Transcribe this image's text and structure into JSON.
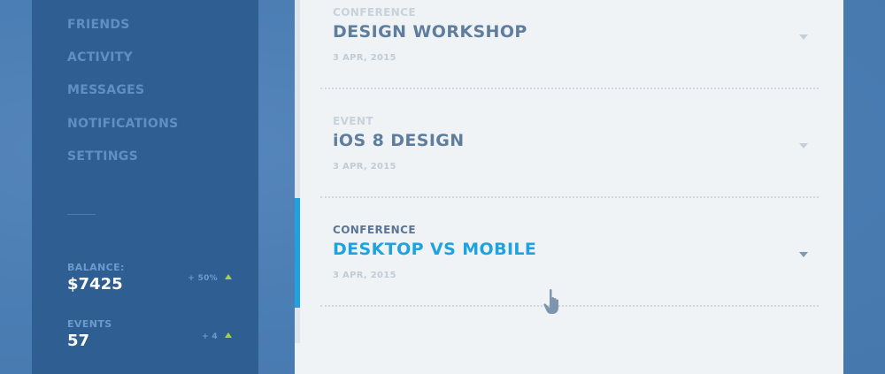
{
  "sidebar": {
    "nav": [
      {
        "label": "FRIENDS"
      },
      {
        "label": "ACTIVITY"
      },
      {
        "label": "MESSAGES"
      },
      {
        "label": "NOTIFICATIONS"
      },
      {
        "label": "SETTINGS"
      }
    ],
    "stats": [
      {
        "label": "BALANCE:",
        "value": "$7425",
        "delta": "+ 50%",
        "trend_icon": "arrow-up-icon"
      },
      {
        "label": "EVENTS",
        "value": "57",
        "delta": "+ 4",
        "trend_icon": "arrow-up-icon"
      }
    ]
  },
  "events": [
    {
      "type": "CONFERENCE",
      "title": "DESIGN WORKSHOP",
      "date": "3 APR, 2015",
      "active": false
    },
    {
      "type": "EVENT",
      "title": "iOS 8 DESIGN",
      "date": "3 APR, 2015",
      "active": false
    },
    {
      "type": "CONFERENCE",
      "title": "DESKTOP VS MOBILE",
      "date": "3 APR, 2015",
      "active": true
    }
  ],
  "colors": {
    "background": "#4a7db3",
    "sidebar": "#2f5f92",
    "panel": "#eff3f6",
    "accent": "#1ea3e0",
    "trend_up": "#a6d04b"
  }
}
